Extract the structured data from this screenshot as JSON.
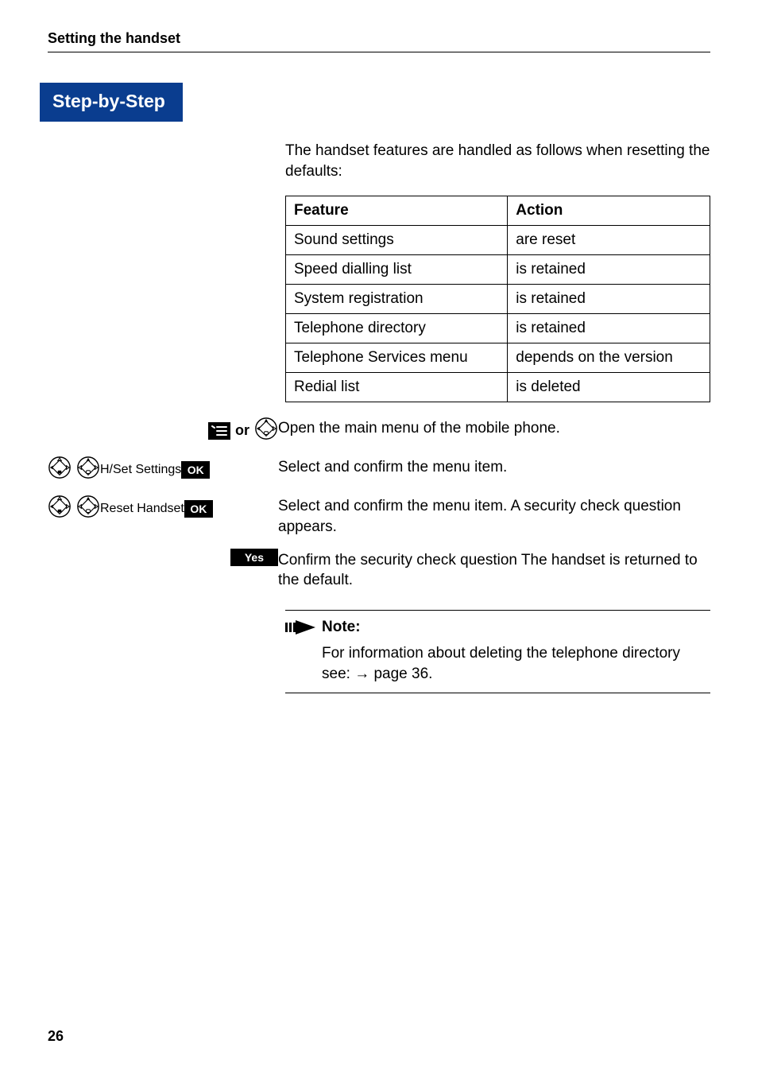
{
  "header": {
    "running_title": "Setting the handset"
  },
  "step_tab": "Step-by-Step",
  "intro": "The handset features are handled as follows when resetting the defaults:",
  "table": {
    "head": {
      "c1": "Feature",
      "c2": "Action"
    },
    "rows": [
      {
        "c1": "Sound settings",
        "c2": "are reset"
      },
      {
        "c1": "Speed dialling list",
        "c2": "is retained"
      },
      {
        "c1": "System registration",
        "c2": "is retained"
      },
      {
        "c1": "Telephone directory",
        "c2": "is retained"
      },
      {
        "c1": "Telephone Services menu",
        "c2": "depends on the version"
      },
      {
        "c1": "Redial list",
        "c2": "is deleted"
      }
    ]
  },
  "steps": {
    "or": "or",
    "open_menu": "Open the main menu of the mobile phone.",
    "hset_label": "H/Set Settings",
    "ok": "OK",
    "select1": "Select and confirm the menu item.",
    "reset_label": "Reset Handset",
    "select2": "Select and confirm the menu item. A security check question appears.",
    "yes": "Yes",
    "confirm": "Confirm the security check question The handset is returned to the default."
  },
  "note": {
    "title": "Note:",
    "body_a": "For information about deleting the telephone directory see: ",
    "arrow": "→",
    "body_b": " page 36."
  },
  "page_number": "26"
}
